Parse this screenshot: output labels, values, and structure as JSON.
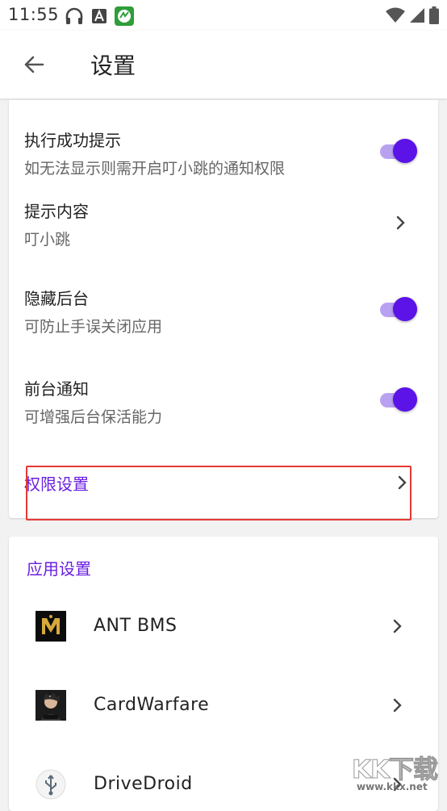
{
  "status_bar": {
    "time": "11:55",
    "left_icons": [
      "headphones-icon",
      "a-icon",
      "app-badge-icon"
    ],
    "right_icons": [
      "wifi-icon",
      "signal-icon",
      "battery-icon"
    ]
  },
  "app_bar": {
    "title": "设置",
    "back_icon": "arrow-left-icon"
  },
  "general_settings": [
    {
      "title": "执行成功提示",
      "subtitle": "如无法显示则需开启叮小跳的通知权限",
      "control": "switch",
      "on": true
    },
    {
      "title": "提示内容",
      "subtitle": "叮小跳",
      "control": "chevron"
    },
    {
      "title": "隐藏后台",
      "subtitle": "可防止手误关闭应用",
      "control": "switch",
      "on": true
    },
    {
      "title": "前台通知",
      "subtitle": "可增强后台保活能力",
      "control": "switch",
      "on": true
    }
  ],
  "permission_settings": {
    "label": "权限设置"
  },
  "app_settings": {
    "header": "应用设置",
    "apps": [
      {
        "name": "ANT BMS",
        "icon": "ant-bms-logo-icon"
      },
      {
        "name": "CardWarfare",
        "icon": "cardwarfare-app-icon"
      },
      {
        "name": "DriveDroid",
        "icon": "usb-icon"
      }
    ]
  },
  "watermark": {
    "text": "KK下载",
    "url": "www.kkx.net"
  },
  "colors": {
    "accent": "#6a1ee0",
    "switch_thumb": "#5b13e8",
    "switch_track": "#b9a1f2",
    "highlight": "#e53935"
  }
}
